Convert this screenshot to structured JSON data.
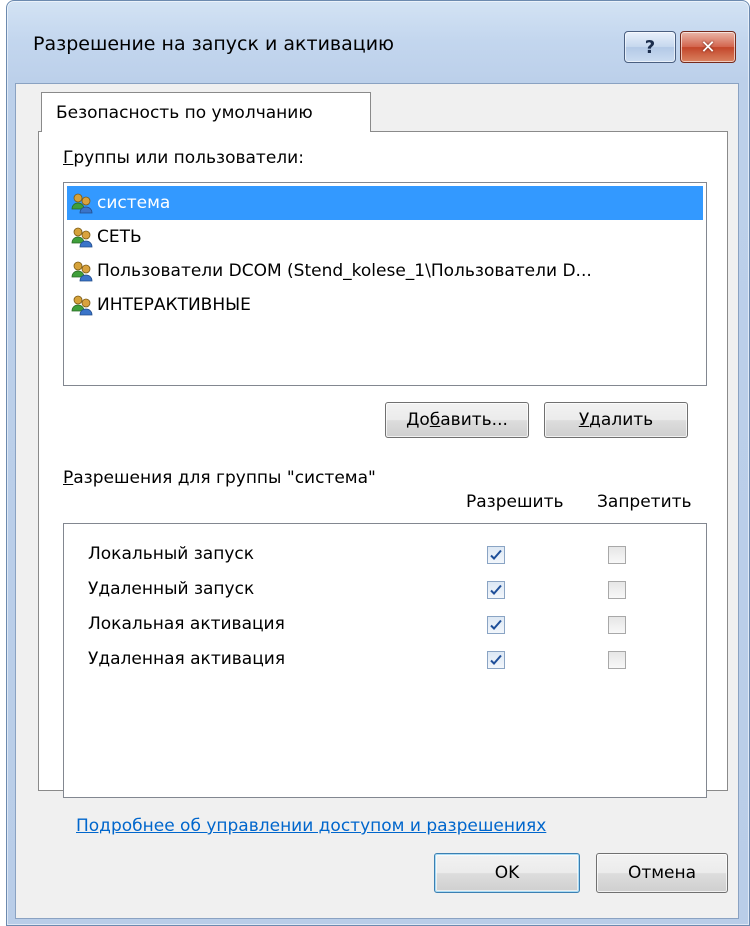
{
  "window": {
    "title": "Разрешение на запуск и активацию",
    "help_glyph": "?",
    "close_glyph": "✕"
  },
  "tab": {
    "label": "Безопасность по умолчанию"
  },
  "groups": {
    "label_accel": "Г",
    "label_rest": "руппы или пользователи:",
    "items": [
      {
        "name": "система",
        "selected": true,
        "icon": "users-icon"
      },
      {
        "name": "СЕТЬ",
        "selected": false,
        "icon": "users-icon"
      },
      {
        "name": "Пользователи DCOM (Stend_kolese_1\\Пользователи D...",
        "selected": false,
        "icon": "users-icon"
      },
      {
        "name": "ИНТЕРАКТИВНЫЕ",
        "selected": false,
        "icon": "users-icon"
      }
    ],
    "add_button": {
      "pre": "До",
      "accel": "б",
      "post": "авить..."
    },
    "remove_button": {
      "accel": "У",
      "post": "далить"
    }
  },
  "permissions": {
    "label_accel": "Р",
    "label_rest": "азрешения для группы \"система\"",
    "col_allow": "Разрешить",
    "col_deny": "Запретить",
    "rows": [
      {
        "label": "Локальный запуск",
        "allow": true,
        "deny": false
      },
      {
        "label": "Удаленный запуск",
        "allow": true,
        "deny": false
      },
      {
        "label": "Локальная активация",
        "allow": true,
        "deny": false
      },
      {
        "label": "Удаленная активация",
        "allow": true,
        "deny": false
      }
    ]
  },
  "link": {
    "text": "Подробнее об управлении доступом и разрешениях"
  },
  "footer": {
    "ok_label": "OK",
    "cancel_label": "Отмена"
  },
  "colors": {
    "selection": "#3399ff",
    "link": "#0066cc"
  }
}
